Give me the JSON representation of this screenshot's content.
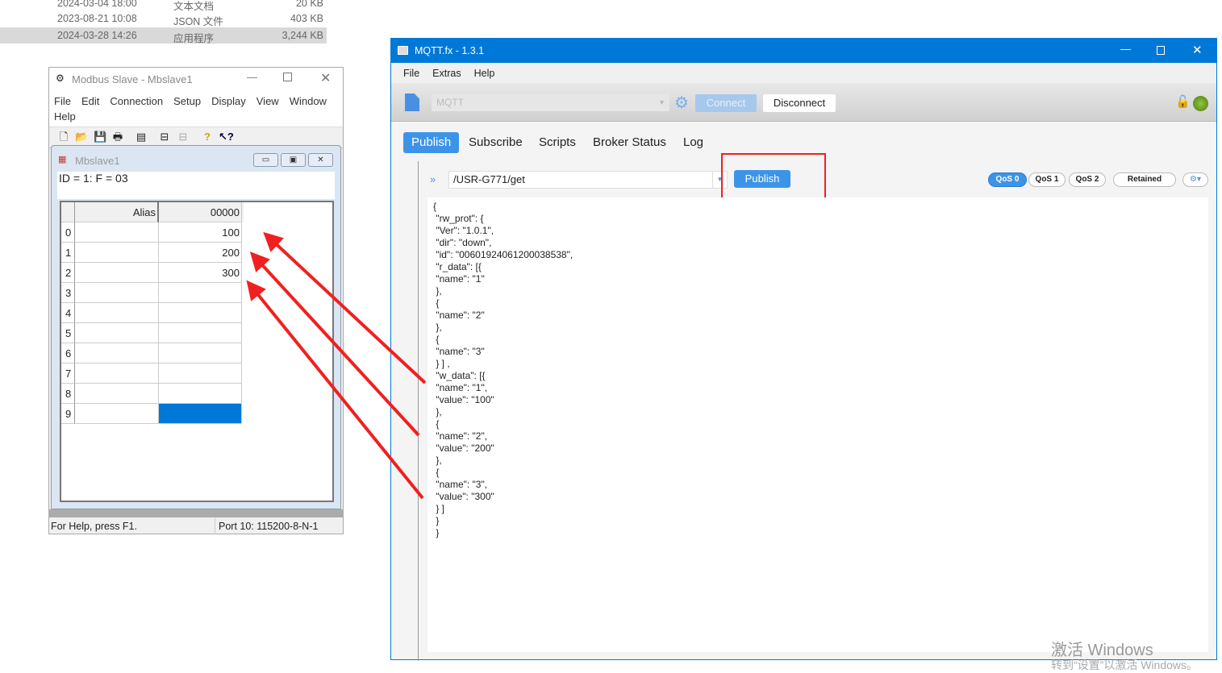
{
  "explorer": {
    "rows": [
      {
        "date": "2024-03-04 18:00",
        "type": "文本文档",
        "size": "20 KB"
      },
      {
        "date": "2023-08-21 10:08",
        "type": "JSON 文件",
        "size": "403 KB"
      },
      {
        "date": "2024-03-28 14:26",
        "type": "应用程序",
        "size": "3,244 KB"
      }
    ]
  },
  "modbus": {
    "title": "Modbus Slave - Mbslave1",
    "menu": [
      "File",
      "Edit",
      "Connection",
      "Setup",
      "Display",
      "View",
      "Window",
      "Help"
    ],
    "child_title": "Mbslave1",
    "info": "ID = 1: F = 03",
    "col_alias": "Alias",
    "col_value": "00000",
    "rows": [
      {
        "i": "0",
        "v": "100"
      },
      {
        "i": "1",
        "v": "200"
      },
      {
        "i": "2",
        "v": "300"
      },
      {
        "i": "3",
        "v": ""
      },
      {
        "i": "4",
        "v": ""
      },
      {
        "i": "5",
        "v": ""
      },
      {
        "i": "6",
        "v": ""
      },
      {
        "i": "7",
        "v": ""
      },
      {
        "i": "8",
        "v": ""
      },
      {
        "i": "9",
        "v": ""
      }
    ],
    "status_help": "For Help, press F1.",
    "status_port": "Port 10: 115200-8-N-1"
  },
  "mqtt": {
    "title": "MQTT.fx - 1.3.1",
    "menu": [
      "File",
      "Extras",
      "Help"
    ],
    "profile": "MQTT",
    "connect": "Connect",
    "disconnect": "Disconnect",
    "tabs": [
      "Publish",
      "Subscribe",
      "Scripts",
      "Broker Status",
      "Log"
    ],
    "topic": "/USR-G771/get",
    "publish": "Publish",
    "qos": [
      "QoS 0",
      "QoS 1",
      "QoS 2"
    ],
    "retained": "Retained",
    "payload": "{\n \"rw_prot\": {\n \"Ver\": \"1.0.1\",\n \"dir\": \"down\",\n \"id\": \"00601924061200038538\",\n \"r_data\": [{\n \"name\": \"1\"\n },\n {\n \"name\": \"2\"\n },\n {\n \"name\": \"3\"\n } ] ,\n \"w_data\": [{\n \"name\": \"1\",\n \"value\": \"100\"\n },\n {\n \"name\": \"2\",\n \"value\": \"200\"\n },\n {\n \"name\": \"3\",\n \"value\": \"300\"\n } ]\n }\n }",
    "accent": "#0078d7"
  },
  "watermark": {
    "line1": "激活 Windows",
    "line2": "转到“设置”以激活 Windows。"
  }
}
